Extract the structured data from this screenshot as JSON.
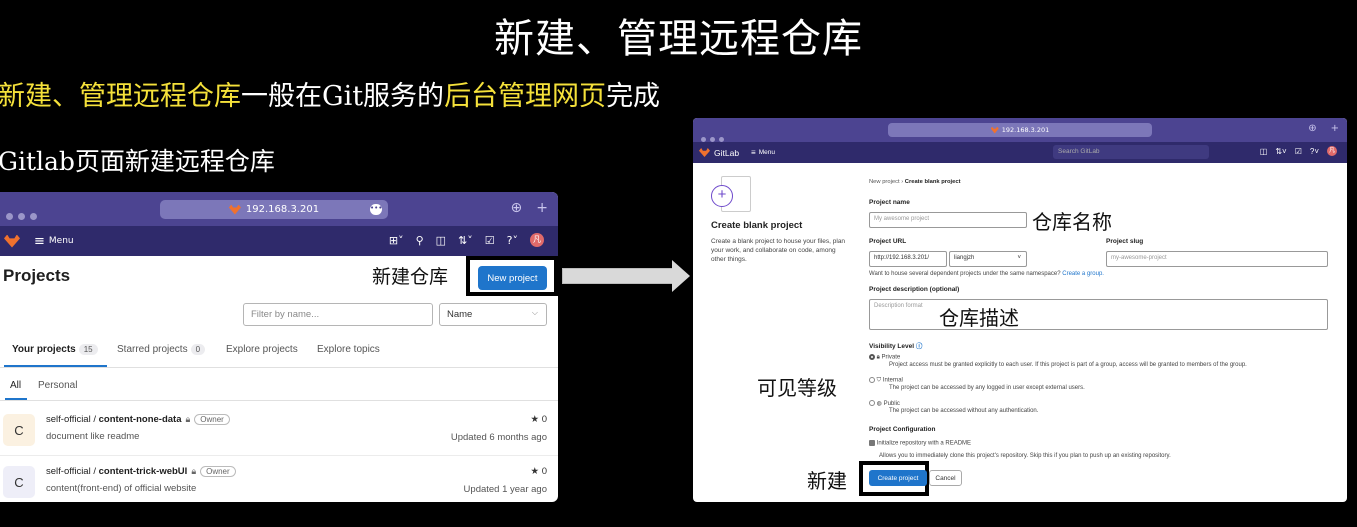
{
  "slide": {
    "title": "新建、管理远程仓库",
    "line1": {
      "part1": "新建、管理远程仓库",
      "part2": "一般在Git服务的",
      "part3": "后台管理网页",
      "part4": "完成"
    },
    "line2": "Gitlab页面新建远程仓库",
    "accent_color": "#f5e13a"
  },
  "left_window": {
    "url": "192.168.3.201",
    "nav": {
      "menu_label": "Menu"
    },
    "page_title": "Projects",
    "callout_label": "新建仓库",
    "new_project_label": "New project",
    "filter_placeholder": "Filter by name...",
    "sort_value": "Name",
    "tabs": [
      {
        "label": "Your projects",
        "count": "15"
      },
      {
        "label": "Starred projects",
        "count": "0"
      },
      {
        "label": "Explore projects"
      },
      {
        "label": "Explore topics"
      }
    ],
    "subtabs": [
      "All",
      "Personal"
    ],
    "projects": [
      {
        "avatar_letter": "C",
        "namespace": "self-official / ",
        "name": "content-none-data",
        "role": "Owner",
        "description": "document like readme",
        "stars": "★ 0",
        "updated": "Updated 6 months ago"
      },
      {
        "avatar_letter": "C",
        "namespace": "self-official / ",
        "name": "content-trick-webUI",
        "role": "Owner",
        "description": "content(front-end) of official website",
        "stars": "★ 0",
        "updated": "Updated 1 year ago"
      }
    ],
    "brand_color": "#1f75cb"
  },
  "right_window": {
    "url": "192.168.3.201",
    "nav": {
      "brand": "GitLab",
      "menu_label": "Menu",
      "search_placeholder": "Search GitLab"
    },
    "breadcrumb": {
      "parent": "New project",
      "separator": "›",
      "current": "Create blank project"
    },
    "side": {
      "title": "Create blank project",
      "description": "Create a blank project to house your files, plan your work, and collaborate on code, among other things."
    },
    "form": {
      "project_name_label": "Project name",
      "project_name_placeholder": "My awesome project",
      "project_url_label": "Project URL",
      "project_url_prefix": "http://192.168.3.201/",
      "namespace": "liangjzh",
      "project_slug_label": "Project slug",
      "project_slug_placeholder": "my-awesome-project",
      "group_hint": "Want to house several dependent projects under the same namespace?",
      "group_link": "Create a group.",
      "description_label": "Project description (optional)",
      "description_placeholder": "Description format",
      "visibility_label": "Visibility Level",
      "visibility": [
        {
          "name": "Private",
          "desc": "Project access must be granted explicitly to each user. If this project is part of a group, access will be granted to members of the group.",
          "selected": true
        },
        {
          "name": "Internal",
          "desc": "The project can be accessed by any logged in user except external users.",
          "selected": false
        },
        {
          "name": "Public",
          "desc": "The project can be accessed without any authentication.",
          "selected": false
        }
      ],
      "config_label": "Project Configuration",
      "readme_label": "Initialize repository with a README",
      "readme_hint": "Allows you to immediately clone this project's repository. Skip this if you plan to push up an existing repository.",
      "create_label": "Create project",
      "cancel_label": "Cancel"
    },
    "annotations": {
      "name": "仓库名称",
      "description": "仓库描述",
      "visibility": "可见等级",
      "create": "新建"
    }
  }
}
